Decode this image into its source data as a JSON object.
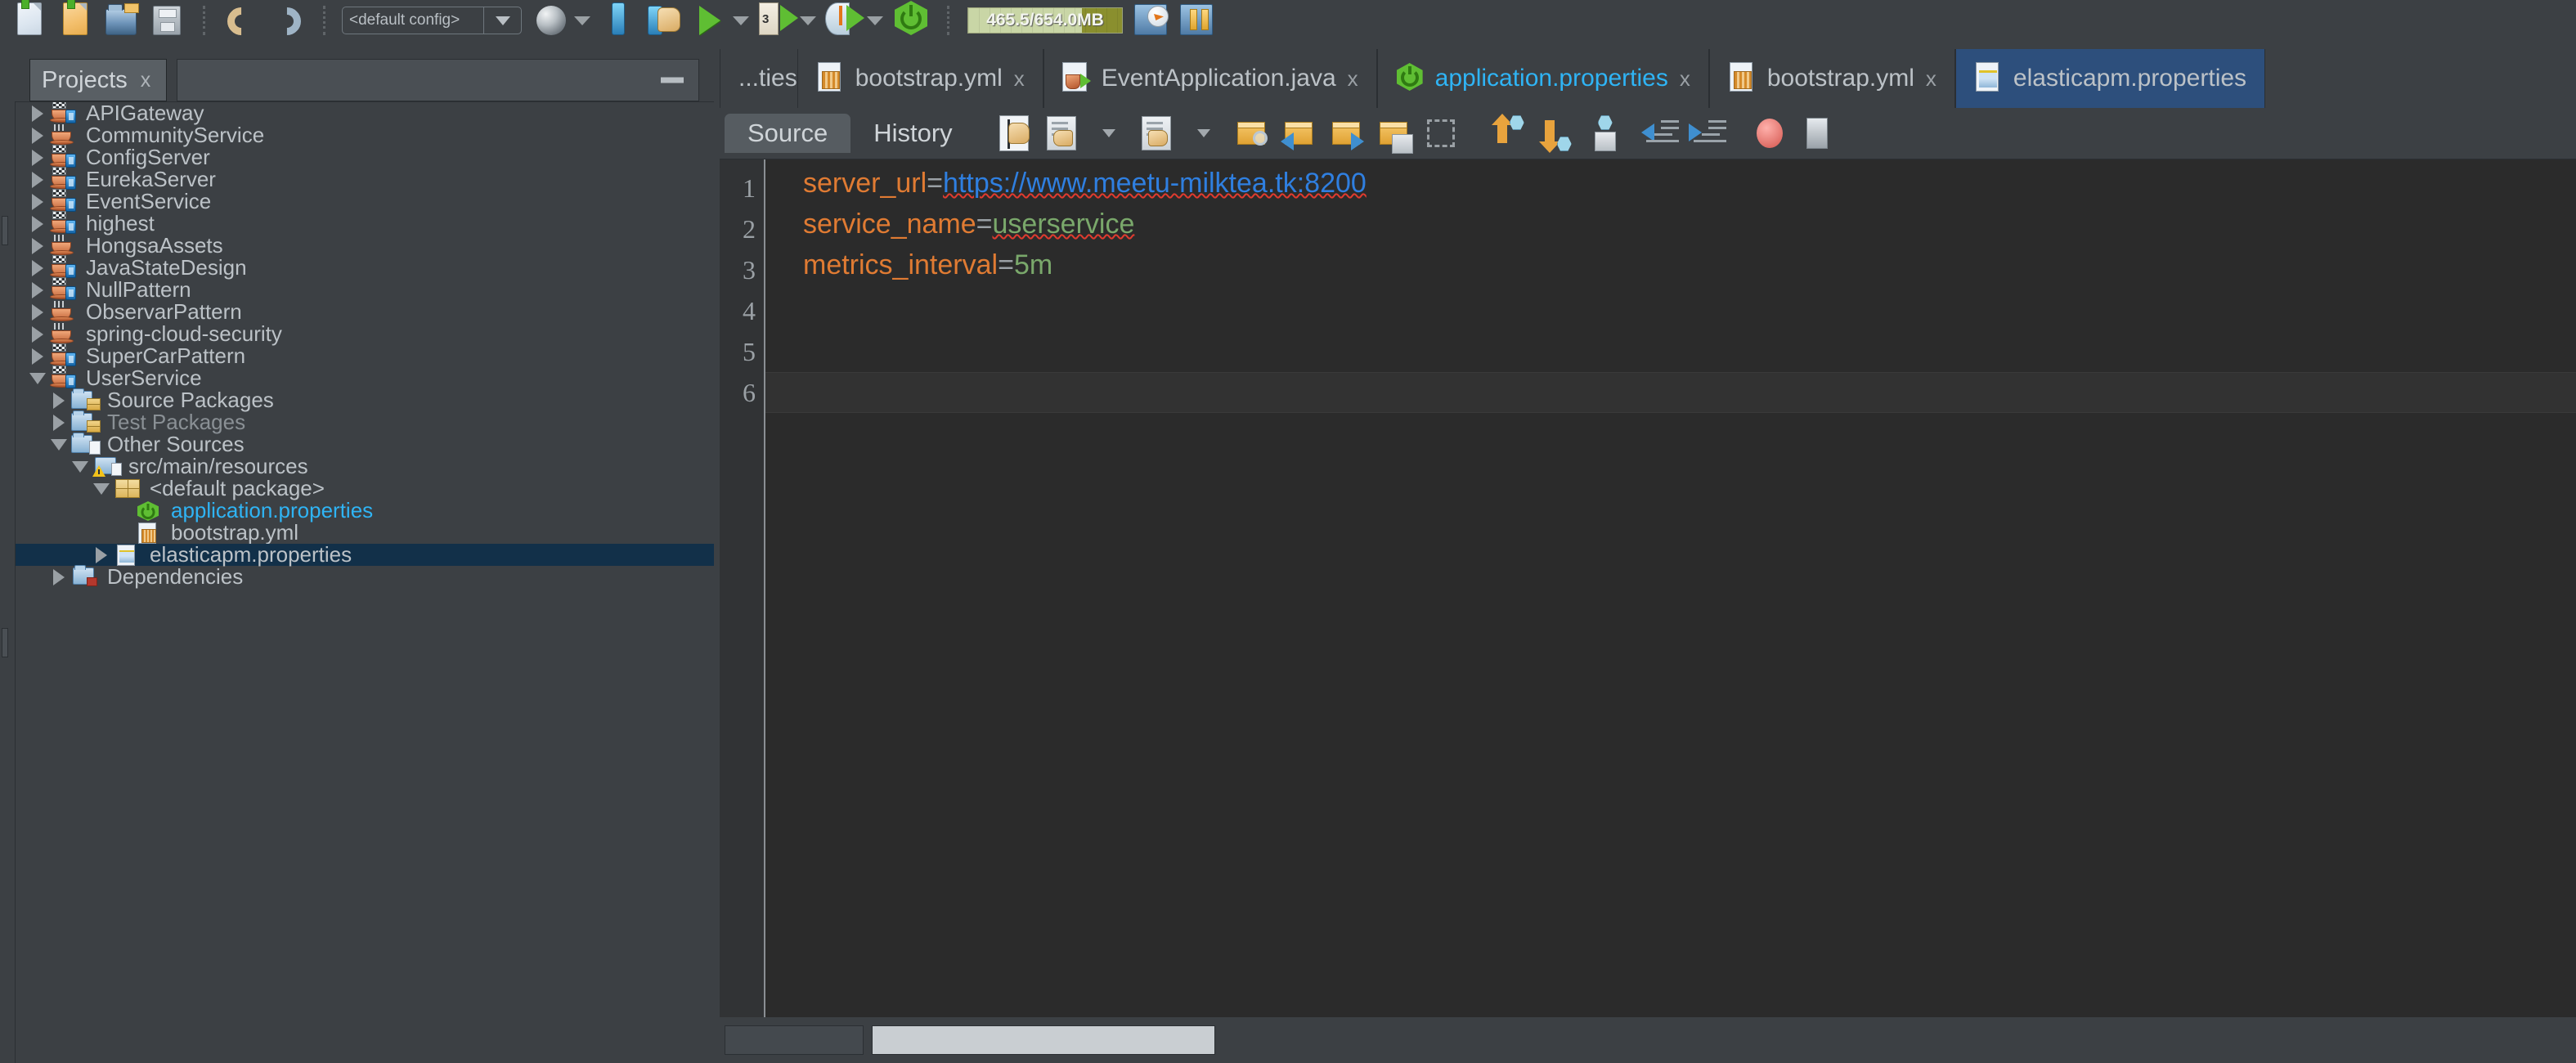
{
  "toolbar": {
    "new_file_label": "New File",
    "new_project_label": "New Project",
    "open_project_label": "Open Project",
    "save_all_label": "Save All",
    "undo_label": "Undo",
    "redo_label": "Redo",
    "config_combo": {
      "value": "<default config>",
      "dropdown_label": "config-dropdown"
    },
    "browser_label": "Browser",
    "tomcat_label": "Tomcat",
    "build_label": "Build Project",
    "run_label": "Run Project",
    "debug_label": "Debug Project",
    "profile_label": "Profile Project",
    "spring_boot_label": "Spring Boot Run",
    "memory_text": "465.5/654.0MB",
    "inspect_label": "Inspect",
    "pause_label": "Pause"
  },
  "projects_panel": {
    "tab_title": "Projects",
    "close_label": "x",
    "minimize_label": "Minimize Window",
    "tree": [
      {
        "label": "APIGateway",
        "indent": 0,
        "twisty": "closed",
        "icon": "java-project-maven",
        "style": "normal"
      },
      {
        "label": "CommunityService",
        "indent": 0,
        "twisty": "closed",
        "icon": "java-project",
        "style": "normal"
      },
      {
        "label": "ConfigServer",
        "indent": 0,
        "twisty": "closed",
        "icon": "java-project-maven",
        "style": "normal"
      },
      {
        "label": "EurekaServer",
        "indent": 0,
        "twisty": "closed",
        "icon": "java-project-maven",
        "style": "normal"
      },
      {
        "label": "EventService",
        "indent": 0,
        "twisty": "closed",
        "icon": "java-project-maven",
        "style": "normal"
      },
      {
        "label": "highest",
        "indent": 0,
        "twisty": "closed",
        "icon": "java-project-maven",
        "style": "normal"
      },
      {
        "label": "HongsaAssets",
        "indent": 0,
        "twisty": "closed",
        "icon": "java-project",
        "style": "normal"
      },
      {
        "label": "JavaStateDesign",
        "indent": 0,
        "twisty": "closed",
        "icon": "java-project-maven",
        "style": "normal"
      },
      {
        "label": "NullPattern",
        "indent": 0,
        "twisty": "closed",
        "icon": "java-project-maven",
        "style": "normal"
      },
      {
        "label": "ObservarPattern",
        "indent": 0,
        "twisty": "closed",
        "icon": "java-project",
        "style": "normal"
      },
      {
        "label": "spring-cloud-security",
        "indent": 0,
        "twisty": "closed",
        "icon": "java-project",
        "style": "normal"
      },
      {
        "label": "SuperCarPattern",
        "indent": 0,
        "twisty": "closed",
        "icon": "java-project-maven",
        "style": "normal"
      },
      {
        "label": "UserService",
        "indent": 0,
        "twisty": "open",
        "icon": "java-project-maven",
        "style": "normal"
      },
      {
        "label": "Source Packages",
        "indent": 1,
        "twisty": "closed",
        "icon": "package-folder",
        "style": "normal"
      },
      {
        "label": "Test Packages",
        "indent": 1,
        "twisty": "closed",
        "icon": "package-folder",
        "style": "muted"
      },
      {
        "label": "Other Sources",
        "indent": 1,
        "twisty": "open",
        "icon": "source-folder",
        "style": "normal"
      },
      {
        "label": "src/main/resources",
        "indent": 2,
        "twisty": "open",
        "icon": "warning-folder",
        "style": "normal"
      },
      {
        "label": "<default package>",
        "indent": 3,
        "twisty": "open",
        "icon": "package",
        "style": "normal"
      },
      {
        "label": "application.properties",
        "indent": 4,
        "twisty": "none",
        "icon": "spring-boot",
        "style": "link"
      },
      {
        "label": "bootstrap.yml",
        "indent": 4,
        "twisty": "none",
        "icon": "yaml-file",
        "style": "normal"
      },
      {
        "label": "elasticapm.properties",
        "indent": 3,
        "twisty": "closed",
        "icon": "properties-file",
        "style": "selected"
      },
      {
        "label": "Dependencies",
        "indent": 1,
        "twisty": "closed",
        "icon": "dependencies-folder",
        "style": "normal"
      }
    ]
  },
  "editor": {
    "tabs": [
      {
        "label": "...ties",
        "icon": "properties-file",
        "closable": false,
        "active": false,
        "partial": true,
        "link": false
      },
      {
        "label": "bootstrap.yml",
        "icon": "yaml-file",
        "closable": true,
        "active": false,
        "partial": false,
        "link": false
      },
      {
        "label": "EventApplication.java",
        "icon": "java-file",
        "closable": true,
        "active": false,
        "partial": false,
        "link": false
      },
      {
        "label": "application.properties",
        "icon": "spring-boot",
        "closable": true,
        "active": false,
        "partial": false,
        "link": true
      },
      {
        "label": "bootstrap.yml",
        "icon": "yaml-file",
        "closable": true,
        "active": false,
        "partial": false,
        "link": false
      },
      {
        "label": "elasticapm.properties",
        "icon": "properties-file",
        "closable": false,
        "active": true,
        "partial": false,
        "link": false
      }
    ],
    "close_glyph": "x",
    "view_tabs": [
      {
        "label": "Source",
        "active": true
      },
      {
        "label": "History",
        "active": false
      }
    ],
    "toolbar_buttons": [
      "toggle-rectangular-selection-icon",
      "last-edit-icon",
      "back-icon",
      "forward-icon",
      "find-selection-icon",
      "previous-bookmark-icon",
      "next-bookmark-icon",
      "toggle-bookmark-icon",
      "toggle-rectangular-icon",
      "shift-line-up-icon",
      "shift-line-down-icon",
      "start-macro-recording-icon",
      "previous-error-icon",
      "next-error-icon",
      "stop-icon",
      "stop-macro-icon"
    ],
    "gutter_lines": [
      "1",
      "2",
      "3",
      "4",
      "5",
      "6"
    ],
    "caret_line": 6,
    "code_lines": [
      {
        "number": "1",
        "tokens": [
          {
            "text": "server_url",
            "type": "key"
          },
          {
            "text": "=",
            "type": "equals"
          },
          {
            "text": "https://www.meetu-milktea.tk:8200",
            "type": "url-spellerror"
          }
        ]
      },
      {
        "number": "2",
        "tokens": [
          {
            "text": "service_name",
            "type": "key"
          },
          {
            "text": "=",
            "type": "equals"
          },
          {
            "text": "userservice",
            "type": "value-spellerror"
          }
        ]
      },
      {
        "number": "3",
        "tokens": [
          {
            "text": "metrics_interval",
            "type": "key"
          },
          {
            "text": "=",
            "type": "equals"
          },
          {
            "text": "5m",
            "type": "value"
          }
        ]
      },
      {
        "number": "4",
        "tokens": []
      },
      {
        "number": "5",
        "tokens": []
      },
      {
        "number": "6",
        "tokens": []
      }
    ]
  },
  "colors": {
    "window_bg": "#3c4044",
    "editor_bg": "#2b2b2b",
    "gutter_bg": "#313335",
    "tree_selection": "#123049",
    "tab_selection": "#2d4f7c",
    "key_orange": "#e07b33",
    "value_green": "#7aa86b",
    "url_blue": "#2f7fe0",
    "link_cyan": "#2fb4f5",
    "spell_error": "#e03b2f",
    "text_primary": "#bcc2c7",
    "spring_green": "#5fbe33"
  }
}
